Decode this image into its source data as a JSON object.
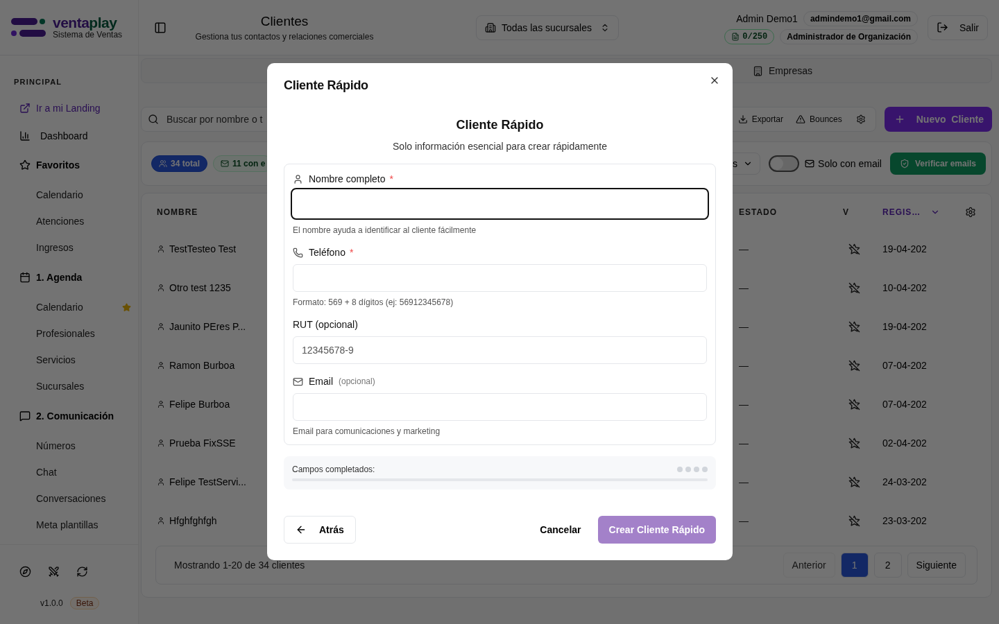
{
  "header": {
    "logo": {
      "part_1": "venta",
      "part_2": "play",
      "tagline": "Sistema de Ventas"
    },
    "title": "Clientes",
    "subtitle": "Gestiona tus contactos y relaciones comerciales",
    "branch_selector": "Todas las sucursales",
    "user": {
      "name": "Admin Demo1",
      "email": "admindemo1@gmail.com",
      "quota": "0/250",
      "role": "Administrador de Organización"
    },
    "logout": "Salir"
  },
  "sidebar": {
    "section": "PRINCIPAL",
    "items": [
      {
        "kind": "link",
        "label": "Ir a mi Landing"
      },
      {
        "kind": "item",
        "label": "Dashboard"
      },
      {
        "kind": "group",
        "label": "Favoritos",
        "children": [
          {
            "label": "Calendario",
            "favorite": false
          },
          {
            "label": "Atenciones",
            "favorite": false
          },
          {
            "label": "Ingresos",
            "favorite": false
          }
        ]
      },
      {
        "kind": "group",
        "label": "1. Agenda",
        "children": [
          {
            "label": "Calendario",
            "favorite": true
          },
          {
            "label": "Profesionales",
            "favorite": false
          },
          {
            "label": "Servicios",
            "favorite": false
          },
          {
            "label": "Sucursales",
            "favorite": false
          }
        ]
      },
      {
        "kind": "group",
        "label": "2. Comunicación",
        "children": [
          {
            "label": "Números",
            "favorite": false
          },
          {
            "label": "Chat",
            "favorite": false
          },
          {
            "label": "Conversaciones",
            "favorite": false
          },
          {
            "label": "Meta plantillas",
            "favorite": false
          }
        ]
      }
    ],
    "version": "v1.0.0",
    "badge": "Beta"
  },
  "tabs": [
    {
      "label": "Empresas",
      "selected": false
    }
  ],
  "toolbar": {
    "search_placeholder": "Buscar por nombre o t",
    "actions": [
      "Exportar",
      "Bounces"
    ],
    "primary": "Nuevo  Cliente"
  },
  "filters": {
    "badges": [
      {
        "label": "34 total",
        "selected": true
      },
      {
        "label": "11 con e",
        "selected": false
      }
    ],
    "dropdown": "s",
    "email_toggle": {
      "label": "Solo con email",
      "on": false
    },
    "verify": "Verificar emails"
  },
  "table": {
    "columns": [
      "NOMBRE",
      "ESTADO",
      "V",
      "REGIS…"
    ],
    "rows": [
      {
        "name": "TestTesteo Test",
        "estado": "—",
        "date": "19-04-202"
      },
      {
        "name": "Otro test 1235",
        "estado": "—",
        "date": "10-04-202"
      },
      {
        "name": "Jaunito PEres P...",
        "estado": "—",
        "date": "19-04-202"
      },
      {
        "name": "Ramon Burboa",
        "estado": "—",
        "date": "07-04-202"
      },
      {
        "name": "Felipe Burboa",
        "estado": "—",
        "date": "07-04-202"
      },
      {
        "name": "Prueba FixSSE",
        "estado": "—",
        "date": "02-04-202"
      },
      {
        "name": "Felipe TestServi...",
        "estado": "—",
        "date": "24-03-202"
      },
      {
        "name": "Hfghfghfgh",
        "estado": "—",
        "date": "23-03-202"
      }
    ],
    "summary": "Mostrando 1-20 de 34 clientes",
    "pagination": {
      "previous": {
        "label": "Anterior",
        "disabled": true
      },
      "pages": [
        {
          "label": "1",
          "selected": true
        },
        {
          "label": "2",
          "selected": false
        }
      ],
      "next": {
        "label": "Siguiente",
        "disabled": false
      }
    }
  },
  "dialog": {
    "title": "Cliente Rápido",
    "heading": "Cliente Rápido",
    "subtitle": "Solo información esencial para crear rápidamente",
    "fields": [
      {
        "kind": "name",
        "label": "Nombre completo",
        "required": true,
        "focused": true,
        "helper": "El nombre ayuda a identificar al cliente fácilmente"
      },
      {
        "kind": "phone",
        "label": "Teléfono",
        "required": true,
        "focused": false,
        "helper": "Formato: 569 + 8 dígitos (ej: 56912345678)"
      },
      {
        "kind": "plain",
        "label": "RUT (opcional)",
        "required": false,
        "focused": false,
        "placeholder": "12345678-9"
      },
      {
        "kind": "email",
        "label": "Email",
        "note": "(opcional)",
        "required": false,
        "focused": false,
        "helper": "Email para comunicaciones y marketing"
      }
    ],
    "progress": {
      "label": "Campos completados:",
      "level": 0,
      "dots": [
        {
          "filled": false
        },
        {
          "filled": false
        },
        {
          "filled": false
        },
        {
          "filled": false
        }
      ]
    },
    "required_mark": "*",
    "back": "Atrás",
    "cancel": "Cancelar",
    "submit": "Crear Cliente Rápido"
  }
}
